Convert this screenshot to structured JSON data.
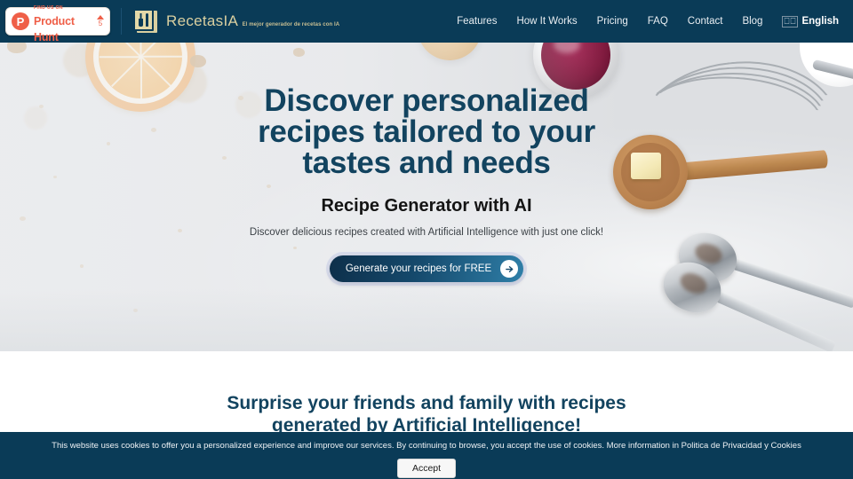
{
  "header": {
    "product_hunt": {
      "find_us_on": "FIND US ON",
      "name": "Product Hunt",
      "upvotes": "5"
    },
    "brand": {
      "name": "RecetasIA",
      "tagline": "El mejor generador de recetas con IA",
      "icon": "recipe-book-cutlery-icon"
    },
    "nav": [
      {
        "label": "Features"
      },
      {
        "label": "How It Works"
      },
      {
        "label": "Pricing"
      },
      {
        "label": "FAQ"
      },
      {
        "label": "Contact"
      },
      {
        "label": "Blog"
      }
    ],
    "language": {
      "flag": "⎕⎕",
      "label": "English"
    }
  },
  "hero": {
    "heading": "Discover personalized recipes tailored to your tastes and needs",
    "subheading": "Recipe Generator with AI",
    "description": "Discover delicious recipes created with Artificial Intelligence with just one click!",
    "cta_label": "Generate your recipes for FREE",
    "cta_icon": "arrow-right-icon"
  },
  "section2": {
    "heading": "Surprise your friends and family with recipes generated by Artificial Intelligence!"
  },
  "cookie": {
    "text": "This website uses cookies to offer you a personalized experience and improve our services. By continuing to browse, you accept the use of cookies. More information in ",
    "link": "Politica de Privacidad y Cookies",
    "accept_label": "Accept"
  },
  "colors": {
    "navy": "#0a3b57",
    "heading_blue": "#12435f",
    "cream": "#d9cfa0",
    "product_hunt_red": "#ef5f48"
  }
}
